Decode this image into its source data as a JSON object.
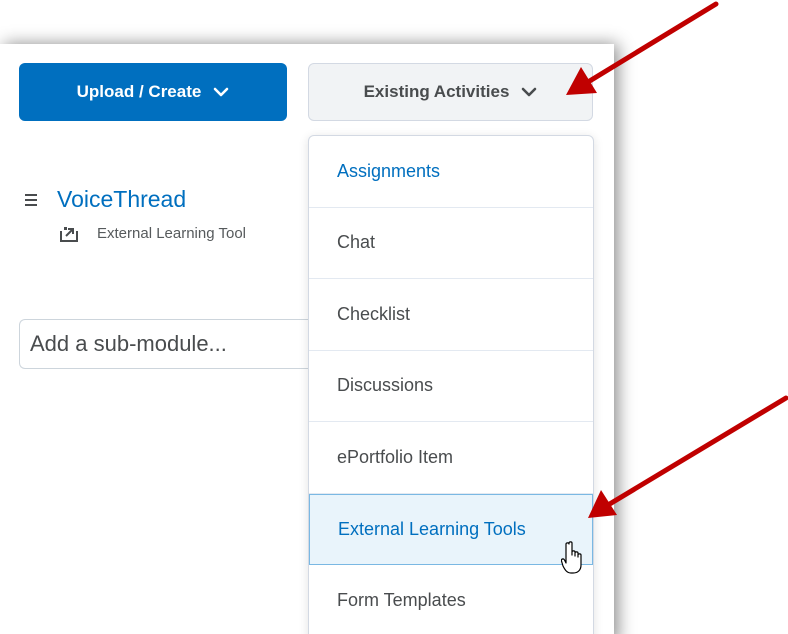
{
  "toolbar": {
    "upload_create_label": "Upload / Create",
    "existing_activities_label": "Existing Activities"
  },
  "module": {
    "title": "VoiceThread",
    "subtitle": "External Learning Tool"
  },
  "sub_module": {
    "placeholder": "Add a sub-module..."
  },
  "dropdown": {
    "items": [
      {
        "label": "Assignments"
      },
      {
        "label": "Chat"
      },
      {
        "label": "Checklist"
      },
      {
        "label": "Discussions"
      },
      {
        "label": "ePortfolio Item"
      },
      {
        "label": "External Learning Tools"
      },
      {
        "label": "Form Templates"
      }
    ],
    "hovered_item": "External Learning Tools"
  },
  "colors": {
    "accent": "#006fbf",
    "annotation_arrow": "#c00000",
    "hover_bg": "#e9f4fb"
  }
}
